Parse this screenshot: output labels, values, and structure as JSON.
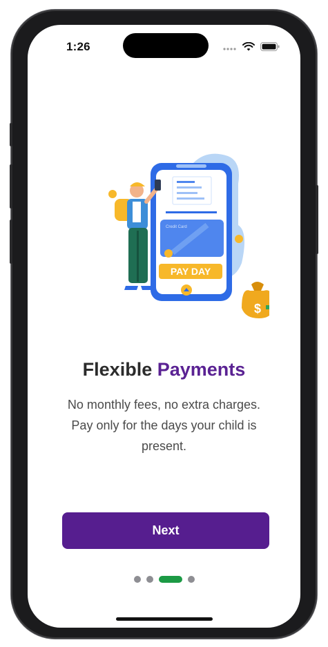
{
  "status_bar": {
    "time": "1:26",
    "icons": [
      "signal-icon",
      "wifi-icon",
      "battery-icon"
    ]
  },
  "illustration": {
    "subject": "payment-illustration",
    "phone_banner_text": "PAY DAY",
    "card_text": "Credit Card"
  },
  "onboarding": {
    "title_prefix": "Flexible",
    "title_accent": "Payments",
    "description": "No monthly fees, no extra charges. Pay only for the days your child is present.",
    "next_label": "Next"
  },
  "pager": {
    "total_pages": 4,
    "current_page": 3
  },
  "colors": {
    "accent": "#5a2293",
    "button": "#561e8f",
    "active_dot": "#1c9a45",
    "inactive_dot": "#8e8e93"
  }
}
